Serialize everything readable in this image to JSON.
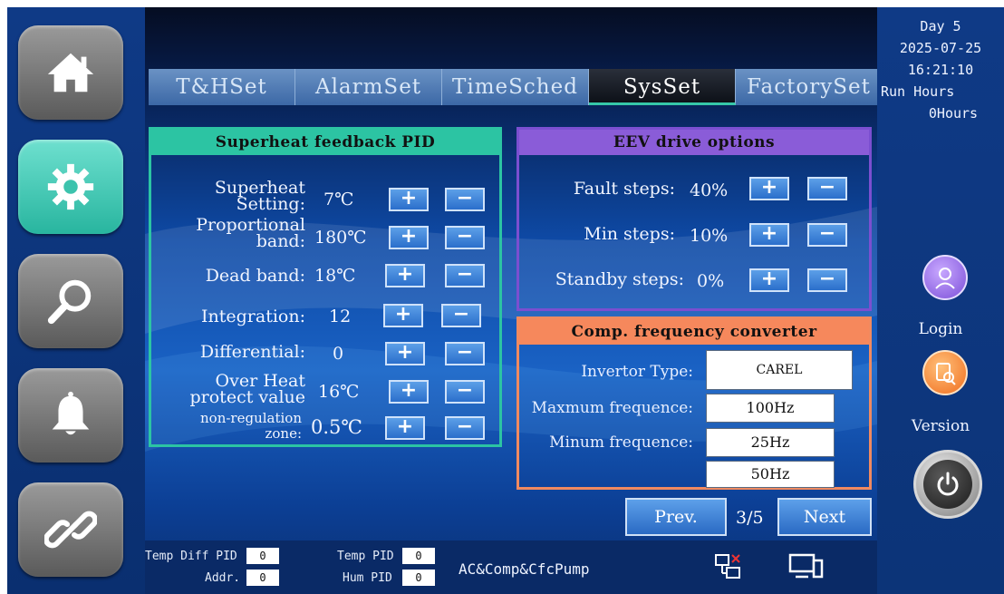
{
  "tabs": [
    {
      "label": "T&HSet"
    },
    {
      "label": "AlarmSet"
    },
    {
      "label": "TimeSched"
    },
    {
      "label": "SysSet",
      "active": true
    },
    {
      "label": "FactorySet"
    }
  ],
  "nav": [
    "home-icon",
    "gear-icon",
    "search-icon",
    "bell-icon",
    "link-icon"
  ],
  "pid_panel": {
    "title": "Superheat feedback PID",
    "rows": [
      {
        "label_line1": "Superheat",
        "label_line2": "Setting:",
        "value": "7℃"
      },
      {
        "label_line1": "Proportional",
        "label_line2": "band:",
        "value": "180℃"
      },
      {
        "label_line1": "Dead band:",
        "value": "18℃"
      },
      {
        "label_line1": "Integration:",
        "value": "12"
      },
      {
        "label_line1": "Differential:",
        "value": "0"
      },
      {
        "label_line1": "Over Heat",
        "label_line2": "protect value",
        "value": "16℃"
      },
      {
        "label_line1": "non-regulation",
        "label_line2": "zone:",
        "value": "0.5℃"
      }
    ]
  },
  "eev_panel": {
    "title": "EEV drive options",
    "rows": [
      {
        "label": "Fault steps:",
        "value": "40%"
      },
      {
        "label": "Min steps:",
        "value": "10%"
      },
      {
        "label": "Standby steps:",
        "value": "0%"
      }
    ]
  },
  "comp_panel": {
    "title": "Comp. frequency converter",
    "invertor_label": "Invertor Type:",
    "invertor_value": "CAREL",
    "max_label": "Maxmum frequence:",
    "max_value": "100Hz",
    "min_label": "Minum frequence:",
    "min_value": "25Hz",
    "extra_value": "50Hz"
  },
  "pager": {
    "prev": "Prev.",
    "page": "3/5",
    "next": "Next"
  },
  "plus": "+",
  "minus": "−",
  "footer": {
    "temp_diff_pid_label": "Temp Diff PID",
    "temp_diff_pid_value": "0",
    "addr_label": "Addr.",
    "addr_value": "0",
    "temp_pid_label": "Temp PID",
    "temp_pid_value": "0",
    "hum_pid_label": "Hum PID",
    "hum_pid_value": "0",
    "mode": "AC&Comp&CfcPump"
  },
  "status": {
    "day": "Day  5",
    "date": "2025-07-25",
    "time": "16:21:10",
    "run_hours_label": "Run Hours",
    "run_hours_value": "0Hours",
    "login": "Login",
    "version": "Version"
  },
  "colors": {
    "pid_accent": "#2cc4a3",
    "eev_accent": "#8a5cd8",
    "comp_accent": "#f6885c"
  }
}
